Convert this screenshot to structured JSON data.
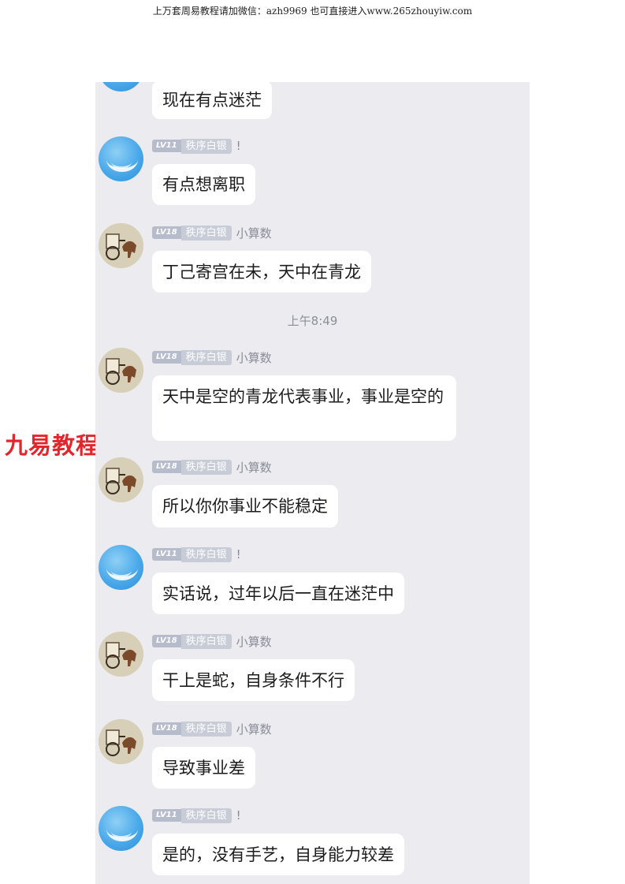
{
  "header": {
    "text": "上万套周易教程请加微信：azh9969   也可直接进入www.265zhouyiw.com"
  },
  "watermark": "九易教程",
  "chat": {
    "time_divider": "上午8:49",
    "badge_lv11": "LV11",
    "badge_lv18": "LV18",
    "badge_title": "秩序白银",
    "sender_a": "!",
    "sender_b": "小算数",
    "messages": [
      {
        "text": "现在有点迷茫"
      },
      {
        "text": "有点想离职"
      },
      {
        "text": "丁己寄宫在未，天中在青龙"
      },
      {
        "text": "天中是空的青龙代表事业，事业是空的"
      },
      {
        "text": "所以你你事业不能稳定"
      },
      {
        "text": "实话说，过年以后一直在迷茫中"
      },
      {
        "text": "干上是蛇，自身条件不行"
      },
      {
        "text": "导致事业差"
      },
      {
        "text": "是的，没有手艺，自身能力较差"
      }
    ]
  },
  "colors": {
    "chat_background": "#ebebf0",
    "bubble": "#ffffff",
    "watermark": "#e2262b"
  }
}
